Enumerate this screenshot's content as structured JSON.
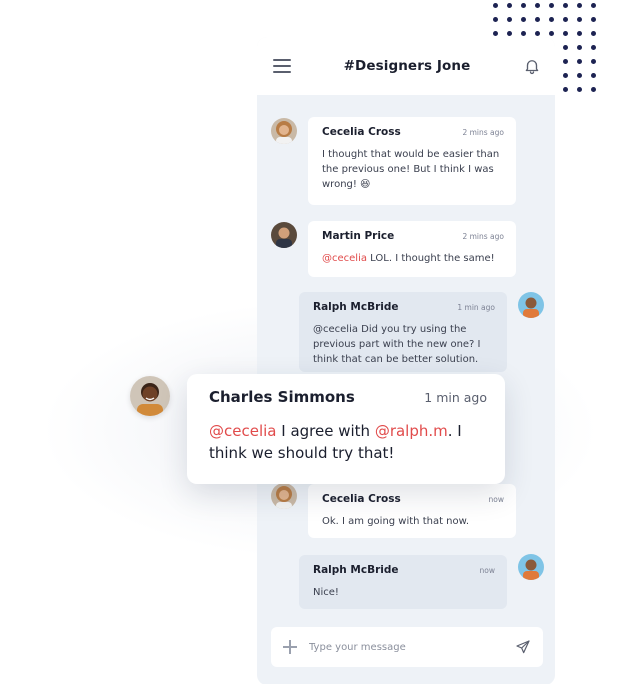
{
  "header": {
    "channel_title": "#Designers Jone"
  },
  "messages": [
    {
      "name": "Cecelia Cross",
      "time": "2 mins ago",
      "text": "I thought that would be easier than the previous one! But I think I was wrong! 😆"
    },
    {
      "name": "Martin Price",
      "time": "2 mins ago",
      "mention": "@cecelia",
      "text": " LOL. I thought the same!"
    },
    {
      "name": "Ralph McBride",
      "time": "1 min ago",
      "text": "@cecelia Did you try using the previous part with the new one? I think that can be better solution."
    },
    {
      "name": "Cecelia Cross",
      "time": "now",
      "text": "Ok. I am going with that now."
    },
    {
      "name": "Ralph McBride",
      "time": "now",
      "text": "Nice!"
    }
  ],
  "featured": {
    "name": "Charles Simmons",
    "time": "1 min ago",
    "mention1": "@cecelia",
    "text1": " I agree with ",
    "mention2": "@ralph.m",
    "text2": ". I think we should try that!"
  },
  "composer": {
    "placeholder": "Type your message"
  },
  "colors": {
    "accent_mention": "#e14b4b",
    "dots": "#1d2352",
    "chat_bg": "#eef2f7"
  },
  "icons": [
    "menu-icon",
    "bell-icon",
    "plus-icon",
    "send-icon"
  ]
}
